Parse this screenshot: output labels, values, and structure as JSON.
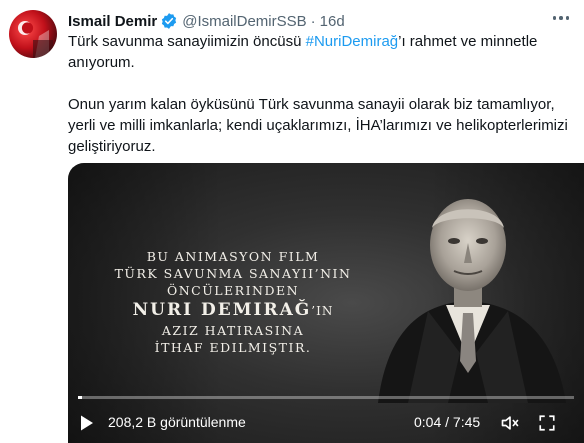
{
  "tweet": {
    "author_name": "Ismail Demir",
    "author_handle": "@IsmailDemirSSB",
    "separator": "·",
    "timestamp": "16d",
    "text_line1_before": "Türk savunma sanayiimizin öncüsü ",
    "hashtag": "#NuriDemirağ",
    "text_line1_after": "’ı rahmet ve minnetle anıyorum.",
    "paragraph2": "Onun yarım kalan öyküsünü Türk savunma sanayii olarak biz tamamlıyor, yerli ve milli imkanlarla; kendi uçaklarımızı, İHA’larımızı ve helikopterlerimizi geliştiriyoruz."
  },
  "video": {
    "overlay_line1": "BU ANIMASYON FILM",
    "overlay_line2": "TÜRK SAVUNMA SANAYII’NIN",
    "overlay_line3": "ÖNCÜLERINDEN",
    "overlay_name": "NURI DEMIRAĞ",
    "overlay_name_suffix": "’IN",
    "overlay_line5": "AZIZ HATIRASINA",
    "overlay_line6": "İTHAF EDILMIŞTIR.",
    "views": "208,2 B görüntülenme",
    "timecode": "0:04 / 7:45",
    "progress": 0.009
  },
  "icons": {
    "verified": "verified-badge-icon",
    "more": "more-options-icon",
    "play": "play-icon",
    "mute": "muted-speaker-icon",
    "fullscreen": "fullscreen-icon"
  },
  "colors": {
    "accent": "#1d9bf0",
    "text": "#0f1419",
    "secondary": "#536471"
  }
}
